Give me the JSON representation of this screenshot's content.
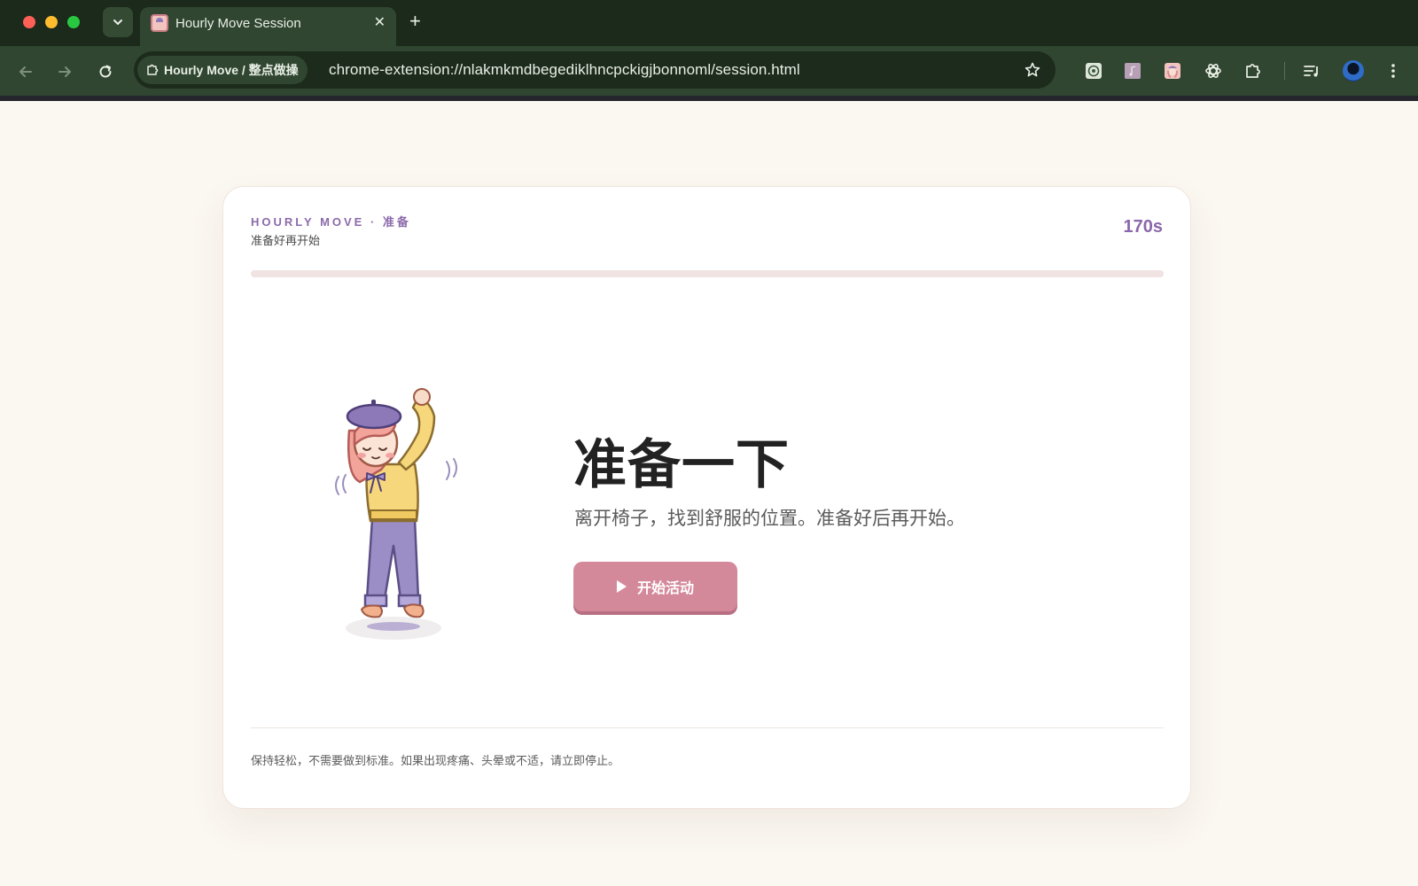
{
  "browser": {
    "tab_title": "Hourly Move Session",
    "site_chip": "Hourly Move / 整点做操",
    "url": "chrome-extension://nlakmkmdbegediklhncpckigjbonnoml/session.html",
    "icons": {
      "tab_search": "chevron-down-icon",
      "new_tab": "plus-icon",
      "back": "arrow-left-icon",
      "forward": "arrow-right-icon",
      "reload": "reload-icon",
      "bookmark": "star-icon",
      "extensions": [
        "chatgpt-icon",
        "music-extension-icon",
        "hourly-move-extension-icon",
        "openai-icon",
        "puzzle-icon",
        "reading-list-icon"
      ],
      "menu": "kebab-menu-icon"
    }
  },
  "session": {
    "brand": "HOURLY MOVE · 准备",
    "subtitle": "准备好再开始",
    "timer": "170s",
    "progress": 0,
    "headline": "准备一下",
    "lead": "离开椅子，找到舒服的位置。准备好后再开始。",
    "start_button": "开始活动",
    "footer_note": "保持轻松，不需要做到标准。如果出现疼痛、头晕或不适，请立即停止。"
  },
  "colors": {
    "page_bg": "#fbf7f1",
    "accent_purple": "#8c6aab",
    "button_pink": "#d4899b",
    "progress_track": "#f0e3e1",
    "chrome_dark": "#1b2a1a",
    "chrome_toolbar": "#304630"
  }
}
